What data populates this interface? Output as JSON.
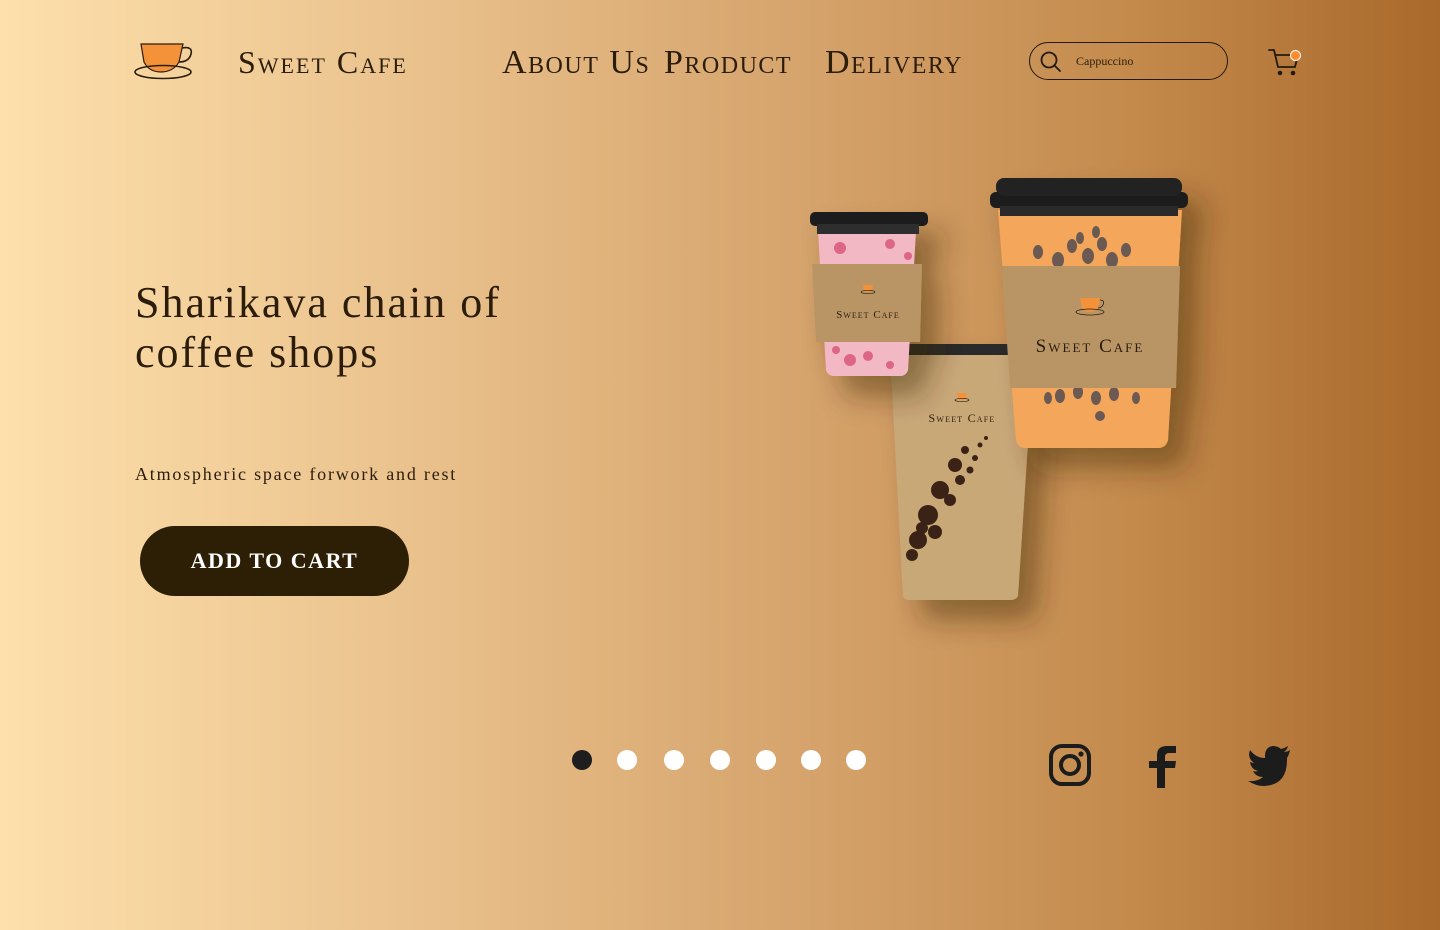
{
  "brand": {
    "name": "Sweet Cafe",
    "logo_icon": "coffee-cup-icon",
    "accent": "#f4923a"
  },
  "nav": [
    {
      "label": "About Us"
    },
    {
      "label": "Product"
    },
    {
      "label": "Delivery"
    }
  ],
  "search": {
    "value": "Cappuccino",
    "icon": "search-icon"
  },
  "cart": {
    "icon": "cart-icon",
    "badge_color": "#ff8a2b"
  },
  "hero": {
    "title": "Sharikava chain of coffee shops",
    "subtitle": "Atmospheric space forwork and rest",
    "cta_label": "ADD TO CART",
    "cup_labels": [
      "Sweet Cafe",
      "Sweet Cafe",
      "Sweet Cafe"
    ]
  },
  "carousel": {
    "slide_count": 7,
    "active_index": 0
  },
  "social": [
    {
      "name": "instagram-icon"
    },
    {
      "name": "facebook-icon"
    },
    {
      "name": "twitter-icon"
    }
  ],
  "colors": {
    "button": "#2d1f05",
    "text": "#2b1d0a"
  }
}
